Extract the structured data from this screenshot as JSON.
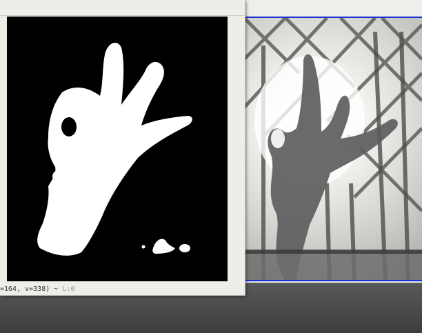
{
  "mask_window": {
    "status_text": "=164, v=338) ~ ",
    "status_suffix": "L:0"
  },
  "colors": {
    "selection_border": "#1b2fd6",
    "mask_background": "#000000",
    "mask_foreground": "#ffffff",
    "window_chrome": "#eeede8"
  },
  "icons": {
    "mask_canvas": "binary-hand-mask",
    "camera_view": "webcam-hand-feed"
  }
}
